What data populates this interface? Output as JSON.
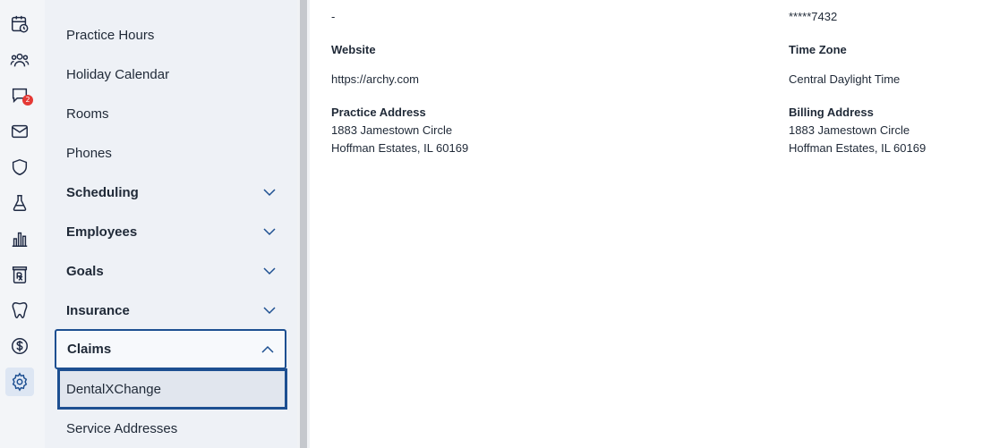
{
  "rail": {
    "items": [
      {
        "name": "schedule-icon"
      },
      {
        "name": "patients-icon"
      },
      {
        "name": "messages-icon",
        "badge": "2"
      },
      {
        "name": "mail-icon"
      },
      {
        "name": "insurance-shield-icon"
      },
      {
        "name": "lab-flask-icon"
      },
      {
        "name": "reports-chart-icon"
      },
      {
        "name": "prescription-icon"
      },
      {
        "name": "tooth-icon"
      },
      {
        "name": "billing-dollar-icon"
      },
      {
        "name": "settings-gear-icon",
        "active": true
      }
    ]
  },
  "nav": {
    "items": [
      {
        "label": "Practice Hours"
      },
      {
        "label": "Holiday Calendar"
      },
      {
        "label": "Rooms"
      },
      {
        "label": "Phones"
      },
      {
        "label": "Scheduling"
      },
      {
        "label": "Employees"
      },
      {
        "label": "Goals"
      },
      {
        "label": "Insurance"
      },
      {
        "label": "Claims"
      },
      {
        "label": "DentalXChange"
      },
      {
        "label": "Service Addresses"
      }
    ]
  },
  "details": {
    "left_top_value": "-",
    "right_top_value": "*****7432",
    "website_label": "Website",
    "website_value": "https://archy.com",
    "timezone_label": "Time Zone",
    "timezone_value": "Central Daylight Time",
    "practice_address_label": "Practice Address",
    "practice_address_line1": "1883 Jamestown Circle",
    "practice_address_line2": "Hoffman Estates, IL 60169",
    "billing_address_label": "Billing Address",
    "billing_address_line1": "1883 Jamestown Circle",
    "billing_address_line2": "Hoffman Estates, IL 60169"
  },
  "colors": {
    "accent": "#1d4f91",
    "badge": "#e53935",
    "icon": "#1f2a44"
  }
}
